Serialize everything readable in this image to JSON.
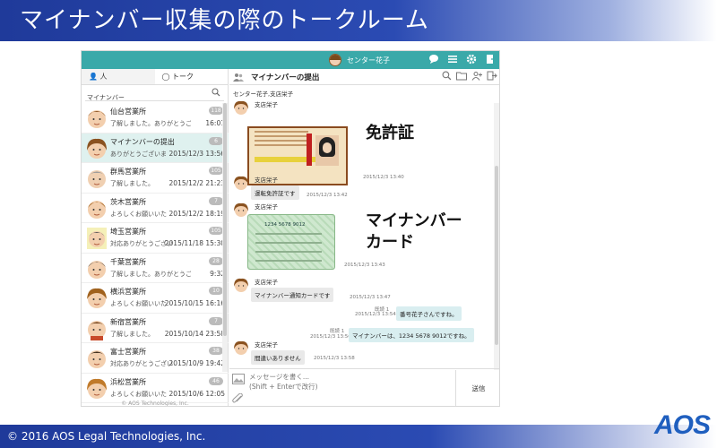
{
  "slide": {
    "title": "マイナンバー収集の際のトークルーム",
    "footer": "© 2016 AOS Legal Technologies, Inc.",
    "logo": "AOS"
  },
  "app": {
    "header_user": "センター花子",
    "accent": "#3aa9a9",
    "tabs": [
      {
        "label": "人"
      },
      {
        "label": "トーク"
      }
    ],
    "search_value": "マイナンバー",
    "conversations": [
      {
        "name": "仙台営業所",
        "message": "了解しました。ありがとうござい",
        "time": "16:01",
        "badge": "118"
      },
      {
        "name": "マイナンバーの提出",
        "message": "ありがとうございま",
        "time": "2015/12/3 13:56",
        "badge": "6"
      },
      {
        "name": "群馬営業所",
        "message": "了解しました。",
        "time": "2015/12/2 21:23",
        "badge": "105"
      },
      {
        "name": "茨木営業所",
        "message": "よろしくお願いいた",
        "time": "2015/12/2 18:19",
        "badge": "7"
      },
      {
        "name": "埼玉営業所",
        "message": "対応ありがとうござい",
        "time": "2015/11/18 15:30",
        "badge": "105"
      },
      {
        "name": "千葉営業所",
        "message": "了解しました。ありがとうござい",
        "time": "9:32",
        "badge": "28"
      },
      {
        "name": "横浜営業所",
        "message": "よろしくお願いいた",
        "time": "2015/10/15 16:16",
        "badge": "10"
      },
      {
        "name": "新宿営業所",
        "message": "了解しました。",
        "time": "2015/10/14 23:58",
        "badge": "7"
      },
      {
        "name": "富士営業所",
        "message": "対応ありがとうござい",
        "time": "2015/10/9 19:42",
        "badge": "38"
      },
      {
        "name": "浜松営業所",
        "message": "よろしくお願いいた",
        "time": "2015/10/6 12:05",
        "badge": "46"
      }
    ],
    "left_footer": "© AOS Technologies, Inc.",
    "room_title": "マイナンバーの提出",
    "members": "センター花子,支店栄子",
    "messages": [
      {
        "sender": "支店栄子",
        "stamp": "2015/12/3 13:40"
      },
      {
        "sender": "支店栄子",
        "text": "運転免許証です",
        "stamp": "2015/12/3 13:42"
      },
      {
        "sender": "支店栄子",
        "stamp": "2015/12/3 13:43",
        "card_number": "1234 5678 9012"
      },
      {
        "sender": "支店栄子",
        "text": "マイナンバー通知カードです",
        "stamp": "2015/12/3 13:47"
      },
      {
        "read": "既読 1",
        "stamp": "2015/12/3 13:54",
        "text": "番号花子さんですね。"
      },
      {
        "read": "既読 1",
        "stamp": "2015/12/3 13:56",
        "text": "マイナンバーは、1234 5678 9012ですね。"
      },
      {
        "sender": "支店栄子",
        "text": "間違いありません",
        "stamp": "2015/12/3 13:58"
      }
    ],
    "composer_placeholder": "メッセージを書く...\n(Shift + Enterで改行)",
    "send_label": "送信"
  },
  "callouts": {
    "license": "免許証",
    "mynumber_line1": "マイナンバー",
    "mynumber_line2": "カード"
  }
}
